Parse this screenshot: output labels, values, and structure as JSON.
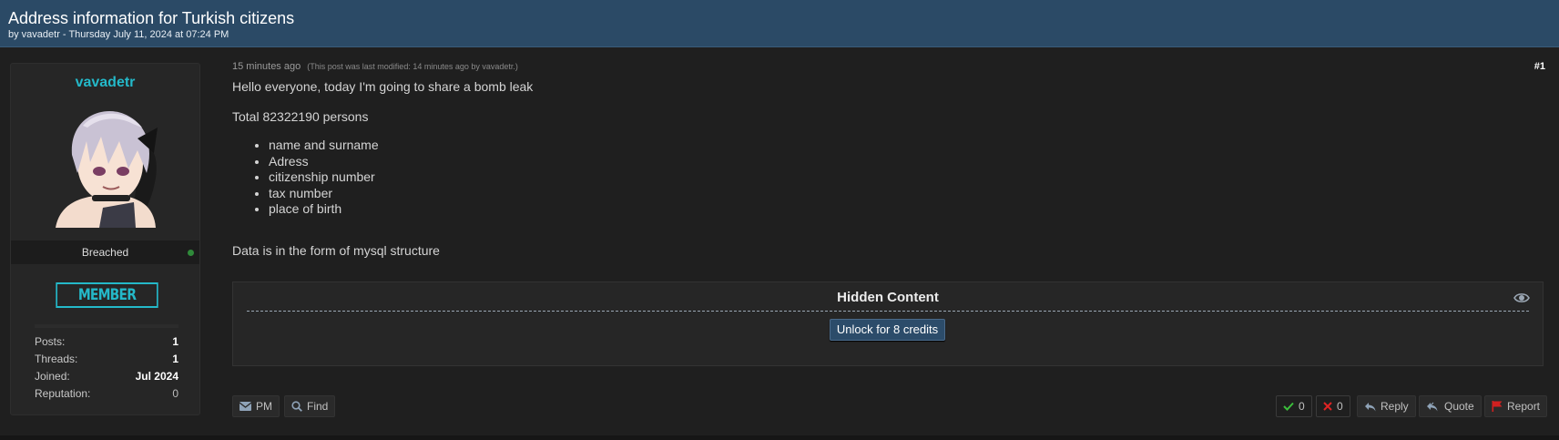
{
  "thread": {
    "title": "Address information for Turkish citizens",
    "byline": "by vavadetr - Thursday July 11, 2024 at 07:24 PM"
  },
  "author": {
    "name": "vavadetr",
    "rank": "Breached",
    "badge": "MEMBER",
    "online": true,
    "stats": [
      {
        "label": "Posts:",
        "value": "1"
      },
      {
        "label": "Threads:",
        "value": "1"
      },
      {
        "label": "Joined:",
        "value": "Jul 2024"
      },
      {
        "label": "Reputation:",
        "value": "0"
      }
    ]
  },
  "post": {
    "time": "15 minutes ago",
    "edited": "(This post was last modified: 14 minutes ago by vavadetr.)",
    "number": "#1",
    "intro": "Hello everyone, today I'm going to share a bomb leak",
    "total": "Total 82322190 persons",
    "fields": [
      "name and surname",
      "Adress",
      "citizenship number",
      "tax number",
      "place of birth"
    ],
    "outro": "Data is in the form of mysql structure"
  },
  "hidden": {
    "title": "Hidden Content",
    "unlock_label": "Unlock for 8 credits"
  },
  "actions": {
    "pm": "PM",
    "find": "Find",
    "upvotes": "0",
    "downvotes": "0",
    "reply": "Reply",
    "quote": "Quote",
    "report": "Report"
  },
  "colors": {
    "header": "#2b4a66",
    "accent": "#24b9c9",
    "background": "#1f1f1f"
  }
}
